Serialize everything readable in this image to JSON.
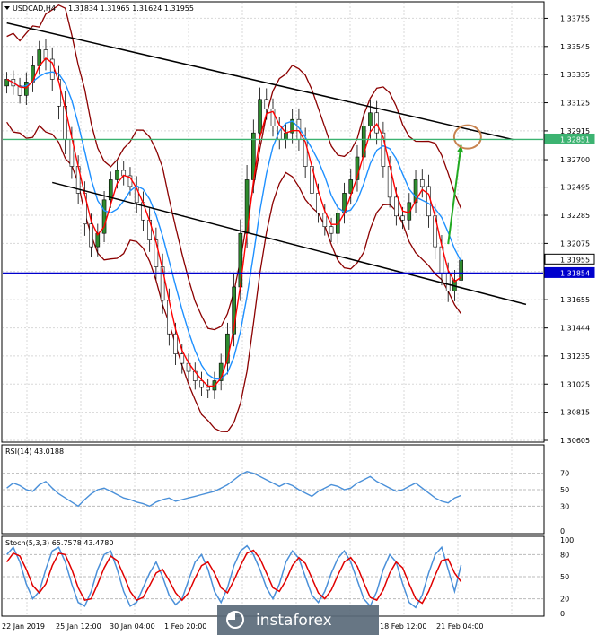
{
  "header": {
    "symbol": "USDCAD,H4",
    "ohlc": "1.31834 1.31965 1.31624 1.31955"
  },
  "chart_data": [
    {
      "type": "candlestick",
      "price_ticks": [
        "1.33755",
        "1.33545",
        "1.33335",
        "1.33125",
        "1.32915",
        "1.32700",
        "1.32495",
        "1.32285",
        "1.32075",
        "1.31865",
        "1.31655",
        "1.31444",
        "1.31235",
        "1.31025",
        "1.30815",
        "1.30605"
      ],
      "ylim": [
        1.30605,
        1.33865
      ],
      "time_labels": [
        "22 Jan 2019",
        "25 Jan 12:00",
        "30 Jan 04:00",
        "1 Feb 20:00",
        "18 Feb 12:00",
        "21 Feb 04:00"
      ],
      "levels": [
        {
          "value": 1.32851,
          "label": "1.32851",
          "color": "#3cb371"
        },
        {
          "value": 1.31854,
          "label": "1.31854",
          "color": "#0000cd"
        },
        {
          "value": 1.31955,
          "label": "1.31955",
          "color": "#ffffff"
        }
      ],
      "close": [
        1.333,
        1.3325,
        1.3318,
        1.3328,
        1.334,
        1.3352,
        1.3345,
        1.333,
        1.331,
        1.3285,
        1.3265,
        1.3245,
        1.3222,
        1.3205,
        1.3215,
        1.324,
        1.3255,
        1.3262,
        1.3258,
        1.325,
        1.3238,
        1.3225,
        1.321,
        1.319,
        1.3165,
        1.314,
        1.3125,
        1.3118,
        1.3112,
        1.3105,
        1.31,
        1.3098,
        1.3105,
        1.3118,
        1.314,
        1.3175,
        1.3215,
        1.3255,
        1.329,
        1.3315,
        1.3308,
        1.3295,
        1.3285,
        1.329,
        1.33,
        1.3285,
        1.3265,
        1.3245,
        1.323,
        1.322,
        1.3215,
        1.323,
        1.3245,
        1.3255,
        1.3272,
        1.3295,
        1.3305,
        1.329,
        1.3265,
        1.3242,
        1.3228,
        1.3225,
        1.3238,
        1.3255,
        1.325,
        1.3228,
        1.3205,
        1.3185,
        1.3172,
        1.318,
        1.3195
      ],
      "volatility": [
        0.001,
        0.0012,
        0.0011,
        0.0013,
        0.0014,
        0.0012,
        0.0015,
        0.0016,
        0.0018,
        0.002,
        0.0017,
        0.0015,
        0.0016,
        0.0014,
        0.0013,
        0.0012,
        0.0011,
        0.0012,
        0.0013,
        0.0012,
        0.0014,
        0.0015,
        0.0016,
        0.0017,
        0.0018,
        0.0016,
        0.0015,
        0.0014,
        0.0013,
        0.0012,
        0.0012,
        0.0011,
        0.0012,
        0.0013,
        0.0015,
        0.0017,
        0.0019,
        0.002,
        0.0018,
        0.0016,
        0.0015,
        0.0014,
        0.0013,
        0.0012,
        0.0014,
        0.0015,
        0.0016,
        0.0015,
        0.0013,
        0.0012,
        0.0012,
        0.0013,
        0.0014,
        0.0015,
        0.0016,
        0.0018,
        0.0017,
        0.0016,
        0.0015,
        0.0014,
        0.0013,
        0.0012,
        0.0013,
        0.0014,
        0.0015,
        0.0016,
        0.0017,
        0.0016,
        0.0015,
        0.0014,
        0.0013
      ],
      "trendlines": [
        {
          "from": [
            0,
            1.3372
          ],
          "to": [
            78,
            1.3285
          ],
          "color": "#000000"
        },
        {
          "from": [
            7,
            1.3253
          ],
          "to": [
            80,
            1.3162
          ],
          "color": "#000000"
        },
        {
          "from": [
            68,
            1.3207
          ],
          "to": [
            70,
            1.3281
          ],
          "color": "#22aa22",
          "arrow": true
        }
      ],
      "circle_marker": {
        "index": 71,
        "value": 1.3287,
        "color": "#c8834f"
      }
    },
    {
      "type": "line",
      "title": "RSI(14) 43.0188",
      "yticks": [
        "70",
        "50",
        "30",
        "0"
      ],
      "ylim": [
        0,
        100
      ],
      "values": [
        52,
        58,
        55,
        50,
        48,
        56,
        60,
        52,
        45,
        40,
        35,
        30,
        38,
        45,
        50,
        52,
        48,
        44,
        40,
        38,
        35,
        33,
        30,
        35,
        38,
        40,
        36,
        38,
        40,
        42,
        44,
        46,
        48,
        52,
        56,
        62,
        68,
        72,
        70,
        66,
        62,
        58,
        54,
        58,
        55,
        50,
        46,
        42,
        48,
        52,
        56,
        54,
        50,
        52,
        58,
        62,
        66,
        60,
        56,
        52,
        48,
        50,
        54,
        58,
        52,
        46,
        40,
        36,
        34,
        40,
        43
      ]
    },
    {
      "type": "line",
      "title": "Stoch(5,3,3) 65.7578 43.4780",
      "yticks": [
        "100",
        "80",
        "50",
        "20",
        "0"
      ],
      "ylim": [
        0,
        100
      ],
      "series": [
        {
          "name": "main",
          "color": "#4a90d9",
          "values": [
            80,
            90,
            70,
            40,
            20,
            30,
            60,
            85,
            90,
            70,
            40,
            15,
            10,
            30,
            60,
            80,
            85,
            60,
            30,
            10,
            15,
            35,
            55,
            70,
            50,
            25,
            12,
            20,
            45,
            70,
            80,
            60,
            30,
            15,
            35,
            65,
            85,
            92,
            80,
            60,
            35,
            20,
            40,
            70,
            85,
            75,
            50,
            25,
            15,
            30,
            55,
            75,
            85,
            70,
            45,
            20,
            10,
            30,
            60,
            80,
            70,
            40,
            15,
            8,
            25,
            55,
            80,
            90,
            60,
            30,
            66
          ]
        },
        {
          "name": "signal",
          "color": "#e00000",
          "values": [
            70,
            82,
            78,
            60,
            38,
            28,
            40,
            65,
            82,
            80,
            60,
            35,
            18,
            20,
            40,
            62,
            78,
            72,
            52,
            30,
            18,
            22,
            38,
            55,
            60,
            45,
            28,
            18,
            28,
            48,
            65,
            70,
            55,
            35,
            28,
            45,
            65,
            82,
            86,
            75,
            55,
            35,
            30,
            45,
            65,
            76,
            68,
            48,
            28,
            20,
            32,
            52,
            70,
            76,
            64,
            42,
            22,
            18,
            32,
            55,
            70,
            62,
            40,
            20,
            14,
            30,
            52,
            72,
            74,
            55,
            43
          ]
        }
      ]
    }
  ],
  "watermark": "instaforex"
}
